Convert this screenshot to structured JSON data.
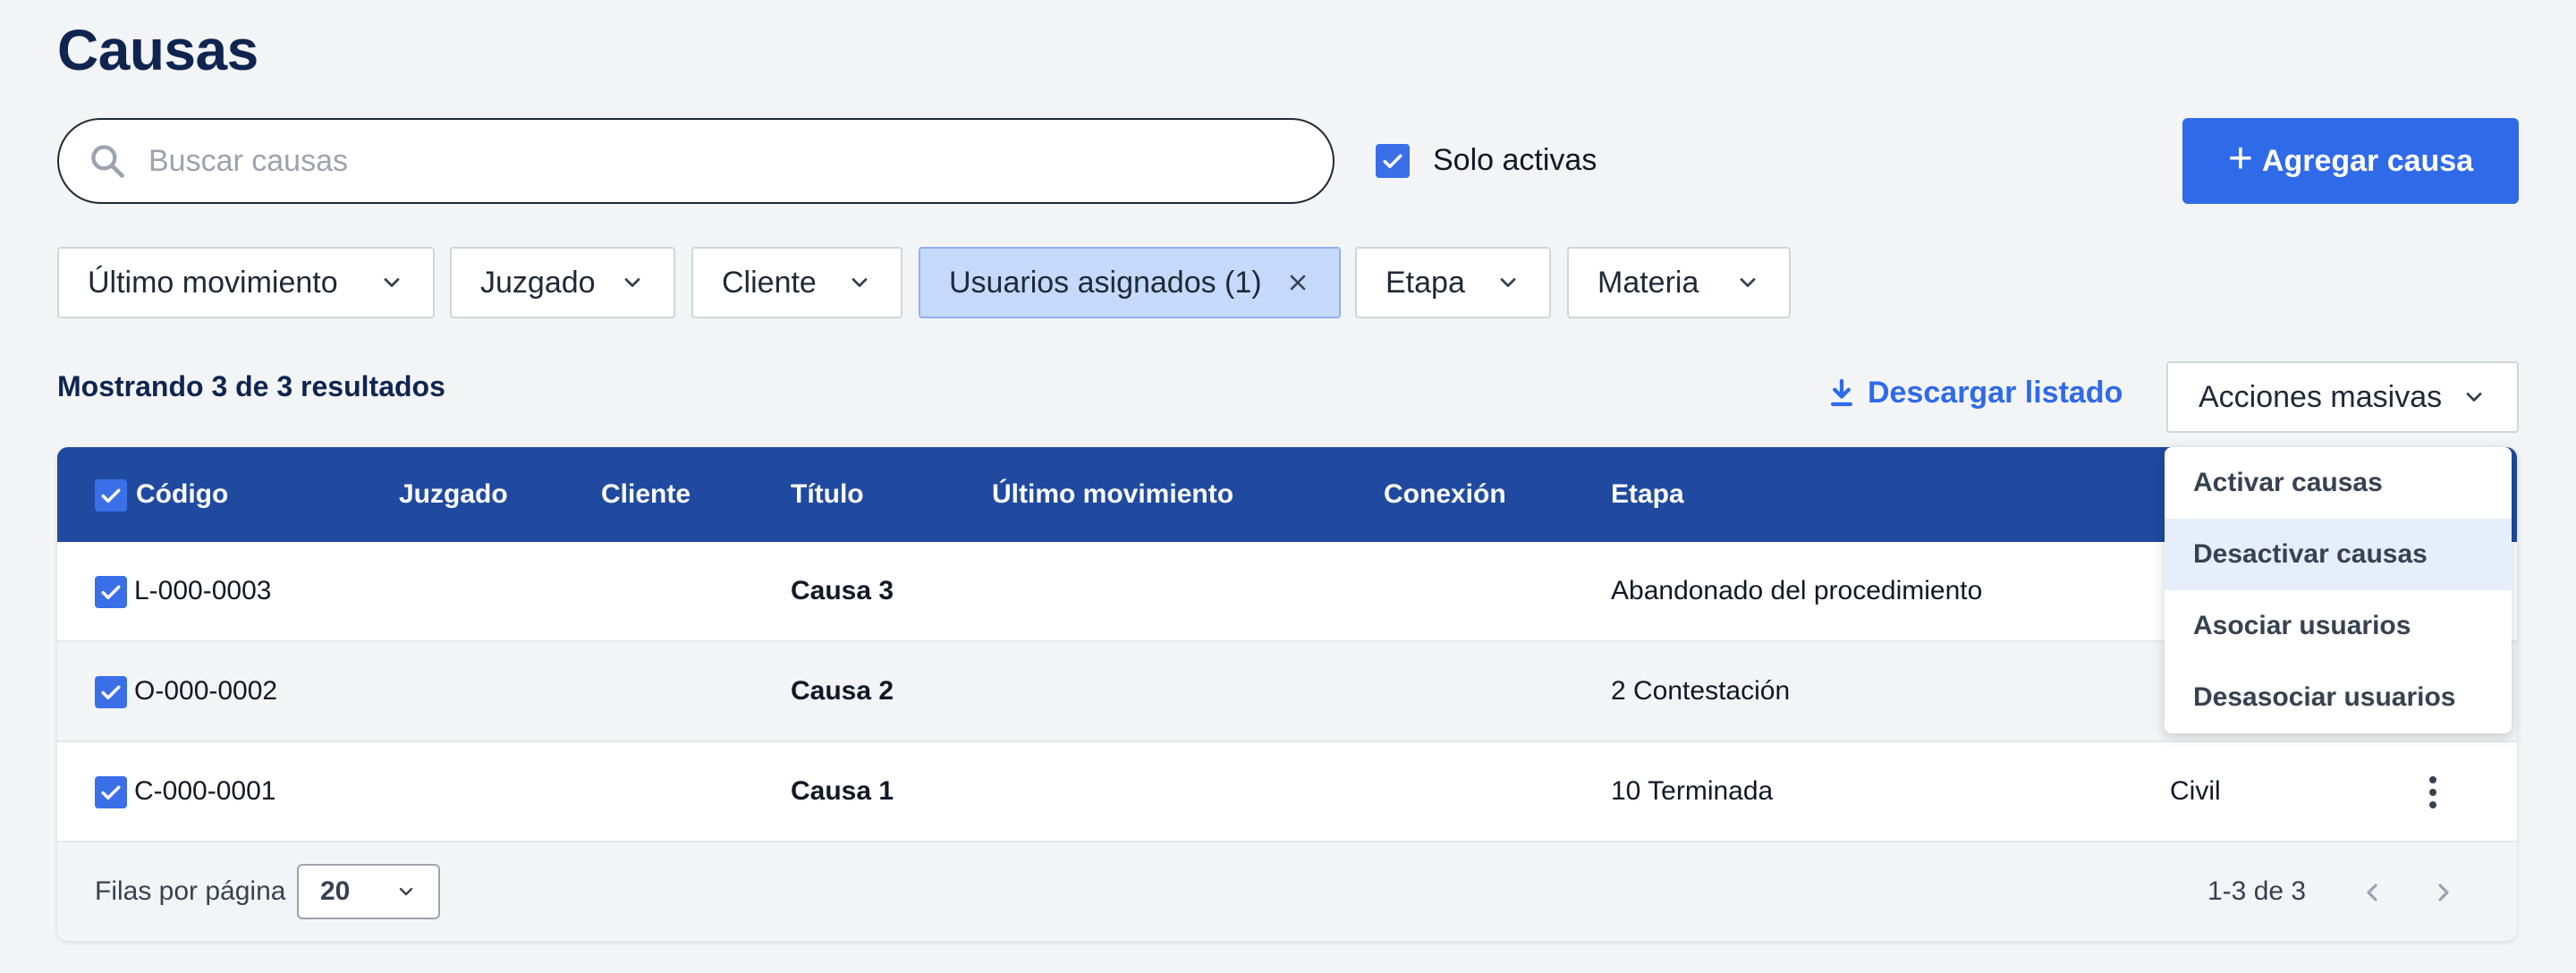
{
  "page": {
    "title": "Causas"
  },
  "search": {
    "placeholder": "Buscar causas",
    "value": ""
  },
  "solo_activas": {
    "label": "Solo activas",
    "checked": true
  },
  "add_button": {
    "label": "Agregar causa"
  },
  "filters": [
    {
      "label": "Último movimiento",
      "active": false
    },
    {
      "label": "Juzgado",
      "active": false
    },
    {
      "label": "Cliente",
      "active": false
    },
    {
      "label": "Usuarios asignados (1)",
      "active": true
    },
    {
      "label": "Etapa",
      "active": false
    },
    {
      "label": "Materia",
      "active": false
    }
  ],
  "results_summary": "Mostrando 3 de 3 resultados",
  "download_label": "Descargar listado",
  "bulk_actions": {
    "label": "Acciones masivas",
    "items": [
      "Activar causas",
      "Desactivar causas",
      "Asociar usuarios",
      "Desasociar usuarios"
    ]
  },
  "table": {
    "columns": [
      "Código",
      "Juzgado",
      "Cliente",
      "Título",
      "Último movimiento",
      "Conexión",
      "Etapa"
    ],
    "rows": [
      {
        "codigo": "L-000-0003",
        "juzgado": "",
        "cliente": "",
        "titulo": "Causa 3",
        "ultimo": "",
        "conexion": "",
        "etapa": "Abandonado del procedimiento",
        "materia": ""
      },
      {
        "codigo": "O-000-0002",
        "juzgado": "",
        "cliente": "",
        "titulo": "Causa 2",
        "ultimo": "",
        "conexion": "",
        "etapa": "2 Contestación",
        "materia": ""
      },
      {
        "codigo": "C-000-0001",
        "juzgado": "",
        "cliente": "",
        "titulo": "Causa 1",
        "ultimo": "",
        "conexion": "",
        "etapa": "10 Terminada",
        "materia": "Civil"
      }
    ]
  },
  "pagination": {
    "rows_label": "Filas por página",
    "rows_value": "20",
    "range": "1-3 de 3"
  },
  "colors": {
    "primary": "#2f6ae9",
    "header": "#1f4aa0",
    "title": "#0f2550",
    "active_filter": "#c5d9fb"
  },
  "icons": {
    "search": "search-icon",
    "chevron": "chevron-down-icon",
    "close": "close-icon",
    "download": "download-icon",
    "kebab": "kebab-icon"
  }
}
